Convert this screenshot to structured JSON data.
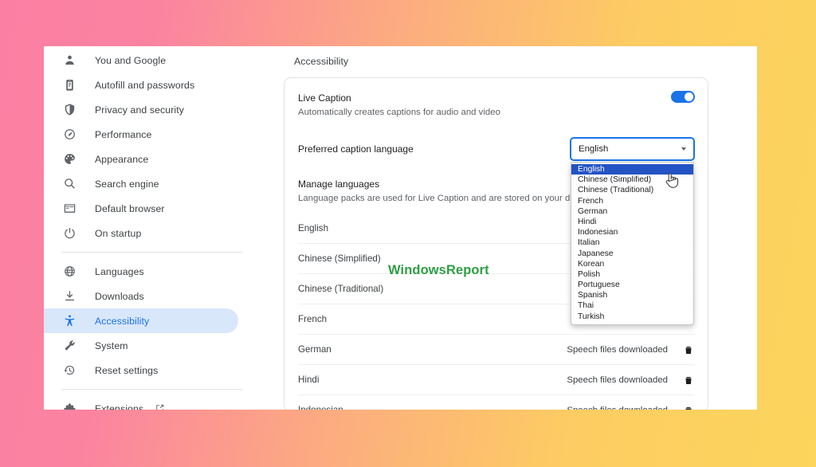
{
  "sidebar": {
    "groups": [
      {
        "items": [
          {
            "label": "You and Google",
            "icon": "person-icon",
            "name": "sidebar-item-you-and-google",
            "active": false
          },
          {
            "label": "Autofill and passwords",
            "icon": "clipboard-icon",
            "name": "sidebar-item-autofill-and-passwords",
            "active": false
          },
          {
            "label": "Privacy and security",
            "icon": "shield-icon",
            "name": "sidebar-item-privacy-and-security",
            "active": false
          },
          {
            "label": "Performance",
            "icon": "speedometer-icon",
            "name": "sidebar-item-performance",
            "active": false
          },
          {
            "label": "Appearance",
            "icon": "palette-icon",
            "name": "sidebar-item-appearance",
            "active": false
          },
          {
            "label": "Search engine",
            "icon": "search-icon",
            "name": "sidebar-item-search-engine",
            "active": false
          },
          {
            "label": "Default browser",
            "icon": "browser-window-icon",
            "name": "sidebar-item-default-browser",
            "active": false
          },
          {
            "label": "On startup",
            "icon": "power-icon",
            "name": "sidebar-item-on-startup",
            "active": false
          }
        ]
      },
      {
        "items": [
          {
            "label": "Languages",
            "icon": "globe-icon",
            "name": "sidebar-item-languages",
            "active": false
          },
          {
            "label": "Downloads",
            "icon": "download-icon",
            "name": "sidebar-item-downloads",
            "active": false
          },
          {
            "label": "Accessibility",
            "icon": "accessibility-icon",
            "name": "sidebar-item-accessibility",
            "active": true
          },
          {
            "label": "System",
            "icon": "wrench-icon",
            "name": "sidebar-item-system",
            "active": false
          },
          {
            "label": "Reset settings",
            "icon": "history-restore-icon",
            "name": "sidebar-item-reset-settings",
            "active": false
          }
        ]
      },
      {
        "items": [
          {
            "label": "Extensions",
            "icon": "puzzle-piece-icon",
            "name": "sidebar-item-extensions",
            "active": false,
            "external": true
          }
        ]
      }
    ]
  },
  "page": {
    "title": "Accessibility"
  },
  "live_caption": {
    "title": "Live Caption",
    "subtitle": "Automatically creates captions for audio and video",
    "toggle_on": true
  },
  "preferred_caption_language": {
    "label": "Preferred caption language",
    "selected": "English",
    "expanded": true,
    "options": [
      "English",
      "Chinese (Simplified)",
      "Chinese (Traditional)",
      "French",
      "German",
      "Hindi",
      "Indonesian",
      "Italian",
      "Japanese",
      "Korean",
      "Polish",
      "Portuguese",
      "Spanish",
      "Thai",
      "Turkish"
    ]
  },
  "manage_languages": {
    "title": "Manage languages",
    "subtitle": "Language packs are used for Live Caption and are stored on your device",
    "rows": [
      {
        "language": "English",
        "status": ""
      },
      {
        "language": "Chinese (Simplified)",
        "status": ""
      },
      {
        "language": "Chinese (Traditional)",
        "status": ""
      },
      {
        "language": "French",
        "status": ""
      },
      {
        "language": "German",
        "status": "Speech files downloaded"
      },
      {
        "language": "Hindi",
        "status": "Speech files downloaded"
      },
      {
        "language": "Indonesian",
        "status": "Speech files downloaded"
      }
    ]
  },
  "watermark": {
    "text": "WindowsReport"
  },
  "colors": {
    "accent": "#1a73e8",
    "active_nav_bg": "#d9e7fb",
    "dropdown_selected": "#2453c4",
    "watermark": "#2e9e44",
    "bg_gradient_start": "#fb7fa3",
    "bg_gradient_end": "#fcd55c"
  }
}
